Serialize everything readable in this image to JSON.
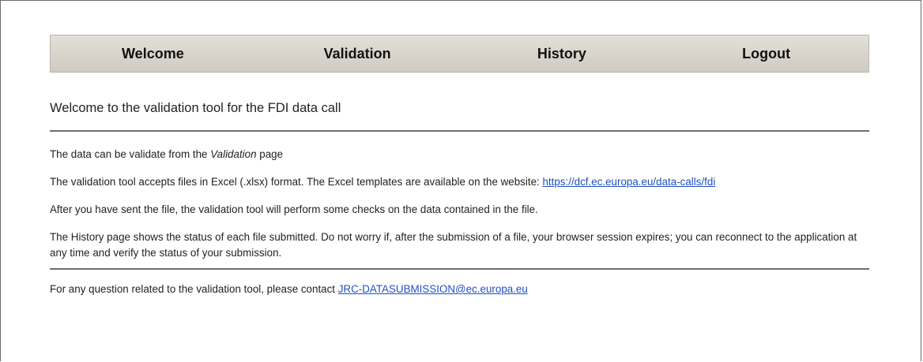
{
  "nav": {
    "items": [
      {
        "label": "Welcome"
      },
      {
        "label": "Validation"
      },
      {
        "label": "History"
      },
      {
        "label": "Logout"
      }
    ]
  },
  "main": {
    "title": "Welcome to the validation tool for the FDI data call",
    "p1": {
      "before": "The data can be validate from the ",
      "emphasis": "Validation",
      "after": " page"
    },
    "p2": {
      "text": "The validation tool accepts files in Excel (.xlsx) format. The Excel templates are available on the website: ",
      "link": "https://dcf.ec.europa.eu/data-calls/fdi"
    },
    "p3": "After you have sent the file, the validation tool will perform some checks on the data contained in the file.",
    "p4": "The History page shows the status of each file submitted. Do not worry if, after the submission of a file, your browser session expires; you can reconnect to the application at any time and verify the status of your submission.",
    "contact": {
      "text": "For any question related to the validation tool, please contact ",
      "email": "JRC-DATASUBMISSION@ec.europa.eu"
    }
  },
  "colors": {
    "link": "#1f4fc4",
    "nav_bg": "#d8d4cc",
    "divider": "#6e6e6e"
  }
}
